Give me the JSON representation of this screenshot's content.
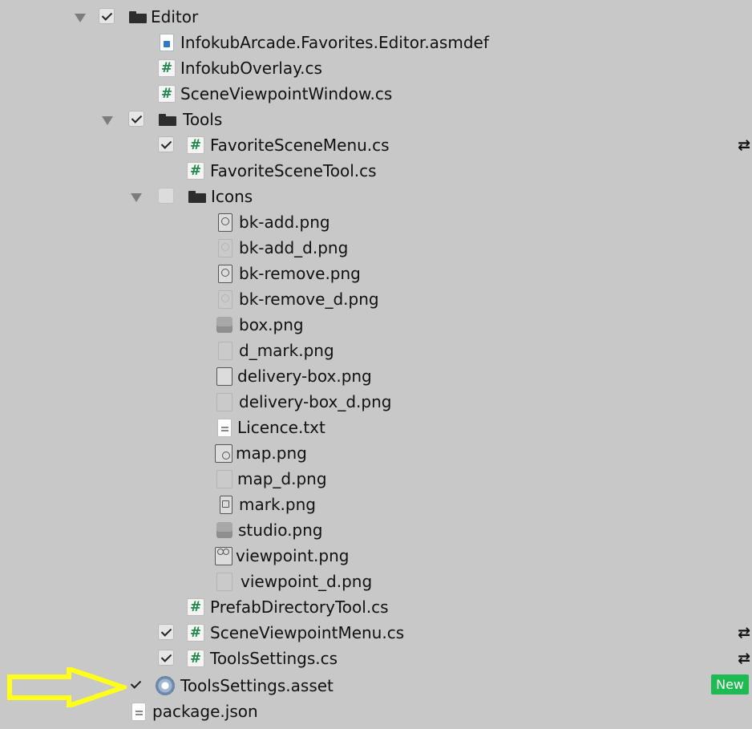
{
  "tree": {
    "editor_folder": "Editor",
    "asmdef_file": "InfokubArcade.Favorites.Editor.asmdef",
    "overlay_file": "InfokubOverlay.cs",
    "viewpoint_window_file": "SceneViewpointWindow.cs",
    "tools_folder": "Tools",
    "favorite_menu_file": "FavoriteSceneMenu.cs",
    "favorite_tool_file": "FavoriteSceneTool.cs",
    "icons_folder": "Icons",
    "icons": [
      "bk-add.png",
      "bk-add_d.png",
      "bk-remove.png",
      "bk-remove_d.png",
      "box.png",
      "d_mark.png",
      "delivery-box.png",
      "delivery-box_d.png",
      "Licence.txt",
      "map.png",
      "map_d.png",
      "mark.png",
      "studio.png",
      "viewpoint.png",
      "viewpoint_d.png"
    ],
    "prefab_tool_file": "PrefabDirectoryTool.cs",
    "viewpoint_menu_file": "SceneViewpointMenu.cs",
    "tools_settings_cs": "ToolsSettings.cs",
    "tools_settings_asset": "ToolsSettings.asset",
    "package_json": "package.json"
  },
  "badges": {
    "new_label": "New",
    "sync_glyph": "⇄"
  },
  "colors": {
    "background": "#c8c8c8",
    "cs_hash": "#1f8a4c",
    "new_badge": "#1fba52",
    "annotation_arrow": "#ffff1a"
  }
}
